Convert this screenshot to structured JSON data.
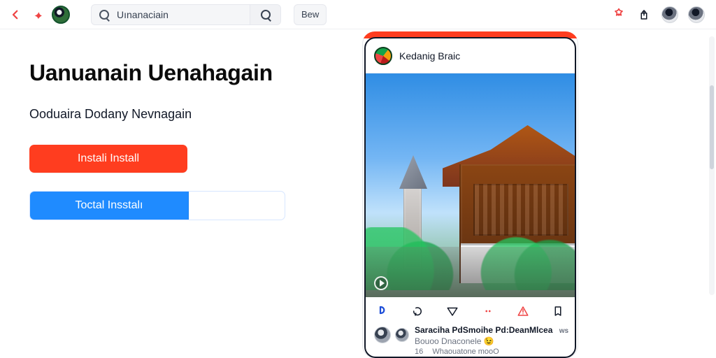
{
  "colors": {
    "accent_red": "#ff3d1f",
    "accent_blue": "#1f8bff"
  },
  "topbar": {
    "search": {
      "placeholder": "Uınanaciain"
    },
    "right_button_label": "Bew"
  },
  "hero": {
    "title": "Uanuanain Uenahagain",
    "subtitle": "Ooduaira Dodany Nevnagain",
    "primary_button_label": "Instali Install",
    "secondary_button_label": "Toctal Insstalı"
  },
  "post": {
    "author_name": "Kedanig Braic",
    "comment": {
      "line1": "Saraciha PdSmoihe Pd:DeanMlcea",
      "line1_tail": "ws",
      "line2": "Bouoo Dnaconele 😉",
      "line3_prefix": "16",
      "line3": "Whaouatone mooO"
    }
  }
}
